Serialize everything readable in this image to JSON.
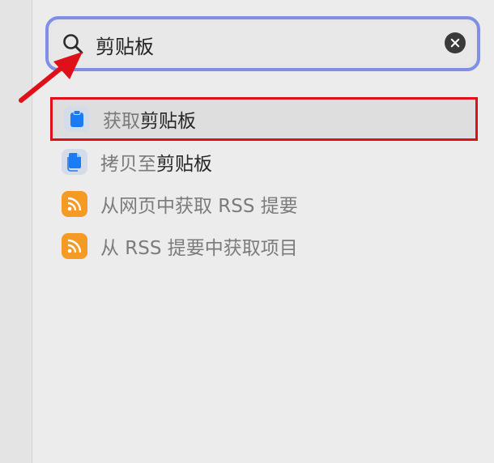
{
  "search": {
    "value": "剪贴板",
    "placeholder": ""
  },
  "results": [
    {
      "label_pre": "获取",
      "label_match": "剪贴板",
      "label_post": "",
      "icon": "clipboard-icon",
      "selected": true
    },
    {
      "label_pre": "拷贝至",
      "label_match": "剪贴板",
      "label_post": "",
      "icon": "copy-documents-icon",
      "selected": false
    },
    {
      "label_pre": "从网页中获取 RSS 提要",
      "label_match": "",
      "label_post": "",
      "icon": "rss-icon",
      "selected": false
    },
    {
      "label_pre": "从 RSS 提要中获取项目",
      "label_match": "",
      "label_post": "",
      "icon": "rss-icon",
      "selected": false
    }
  ],
  "colors": {
    "highlight_box": "#e0101a",
    "search_ring": "#7f8fe6",
    "rss_orange": "#f59a23",
    "clipboard_blue": "#1a7cf5"
  }
}
